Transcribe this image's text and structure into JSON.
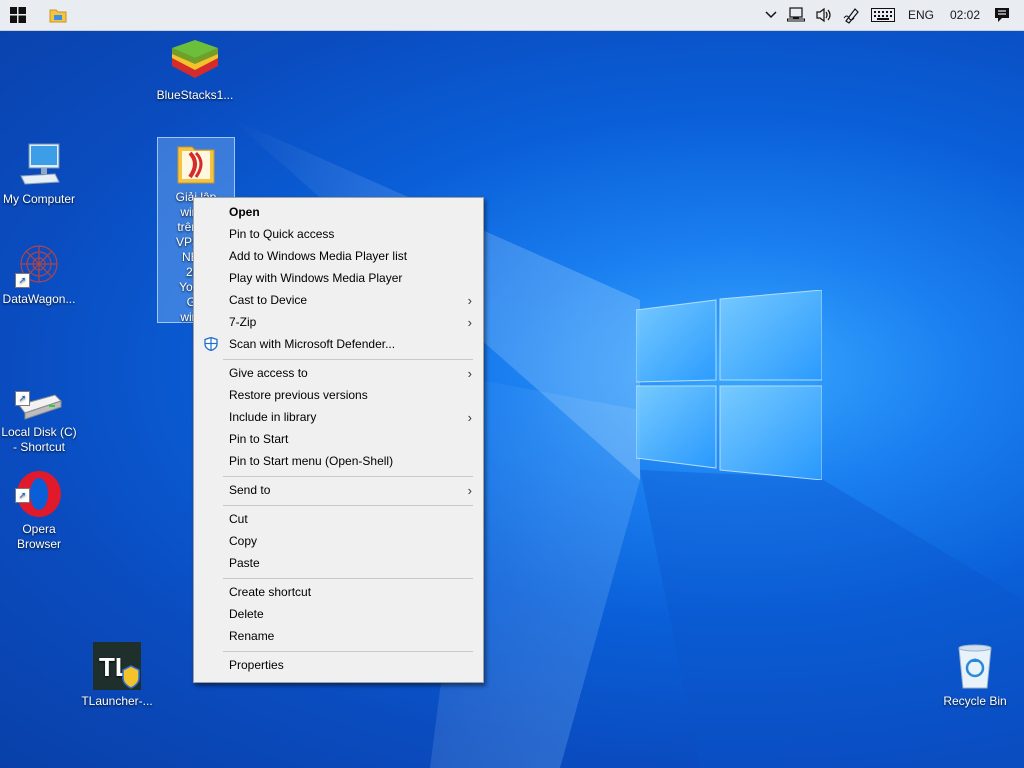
{
  "taskbar": {
    "start_icon": "windows-logo-icon",
    "explorer_icon": "file-explorer-icon",
    "tray": {
      "chevron": "chevron-up-icon",
      "network": "network-icon",
      "volume": "volume-icon",
      "pen": "pen-icon",
      "keyboard": "keyboard-icon",
      "language": "ENG",
      "time": "02:02",
      "notifications": "notification-icon"
    }
  },
  "desktop": {
    "icons": [
      {
        "label": "BlueStacks1...",
        "icon": "bluestacks-icon"
      },
      {
        "label": "My Computer",
        "icon": "computer-icon"
      },
      {
        "label": "DataWagon...",
        "icon": "datawagon-icon"
      },
      {
        "label": "Local Disk (C)\n- Shortcut",
        "icon": "drive-icon"
      },
      {
        "label": "Opera\nBrowser",
        "icon": "opera-icon"
      },
      {
        "label": "TLauncher-...",
        "icon": "tlauncher-icon"
      },
      {
        "label": "Recycle Bin",
        "icon": "recycle-bin-icon"
      }
    ],
    "selected_file": {
      "label_lines": [
        "Giải lập",
        "windo",
        "trên qe",
        "VPS (H",
        "NEW",
        "202",
        "YouTu",
        "Giả",
        "windo"
      ]
    }
  },
  "context_menu": {
    "items": [
      {
        "label": "Open",
        "bold": true
      },
      {
        "label": "Pin to Quick access"
      },
      {
        "label": "Add to Windows Media Player list"
      },
      {
        "label": "Play with Windows Media Player"
      },
      {
        "label": "Cast to Device",
        "submenu": true
      },
      {
        "label": "7-Zip",
        "submenu": true
      },
      {
        "label": "Scan with Microsoft Defender...",
        "icon": "defender-shield-icon"
      },
      {
        "label": "Give access to",
        "submenu": true
      },
      {
        "label": "Restore previous versions"
      },
      {
        "label": "Include in library",
        "submenu": true
      },
      {
        "label": "Pin to Start"
      },
      {
        "label": "Pin to Start menu (Open-Shell)"
      },
      {
        "label": "Send to",
        "submenu": true
      },
      {
        "label": "Cut"
      },
      {
        "label": "Copy"
      },
      {
        "label": "Paste"
      },
      {
        "label": "Create shortcut"
      },
      {
        "label": "Delete"
      },
      {
        "label": "Rename"
      },
      {
        "label": "Properties"
      }
    ],
    "submenu_glyph": "›"
  },
  "colors": {
    "taskbar_bg": "#e9edf2",
    "menu_bg": "#f0f0f0",
    "desktop_blue": "#0a5fd8",
    "selection": "#99ccff"
  }
}
